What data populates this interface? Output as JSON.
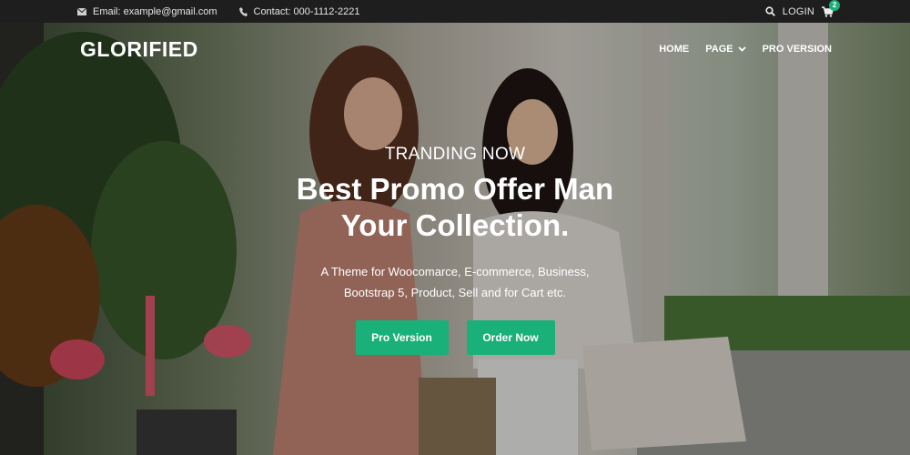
{
  "topbar": {
    "email": "Email: example@gmail.com",
    "contact": "Contact: 000-1112-2221",
    "login": "LOGIN",
    "cart_count": "2"
  },
  "nav": {
    "logo": "GLORIFIED",
    "items": [
      {
        "label": "HOME"
      },
      {
        "label": "PAGE"
      },
      {
        "label": "PRO VERSION"
      }
    ]
  },
  "hero": {
    "eyebrow": "TRANDING NOW",
    "headline_line1": "Best Promo Offer Man",
    "headline_line2": "Your Collection.",
    "desc_line1": "A Theme for Woocomarce, E-commerce, Business,",
    "desc_line2": "Bootstrap 5, Product, Sell and for Cart etc.",
    "btn_primary": "Pro Version",
    "btn_secondary": "Order Now"
  },
  "colors": {
    "accent": "#19b079",
    "topbar_bg": "#1e1e1e"
  },
  "icons": [
    "envelope-icon",
    "phone-icon",
    "search-icon",
    "cart-icon",
    "chevron-down-icon"
  ]
}
